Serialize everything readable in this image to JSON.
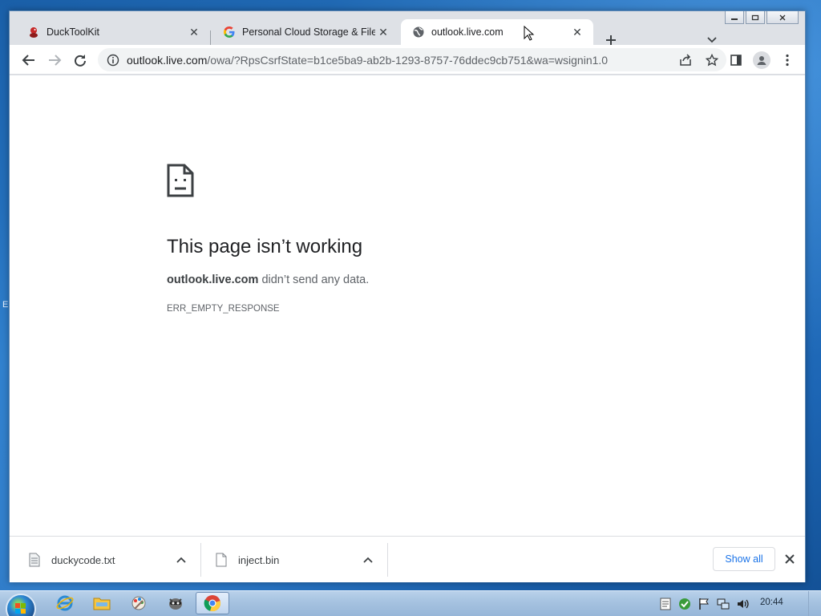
{
  "browser": {
    "tabs": [
      {
        "title": "DuckToolKit",
        "icon": "duck-favicon-icon",
        "active": false
      },
      {
        "title": "Personal Cloud Storage & File Sh",
        "icon": "google-favicon-icon",
        "active": false
      },
      {
        "title": "outlook.live.com",
        "icon": "globe-favicon-icon",
        "active": true
      }
    ],
    "url": {
      "host": "outlook.live.com",
      "rest": "/owa/?RpsCsrfState=b1ce5ba9-ab2b-1293-8757-76ddec9cb751&wa=wsignin1.0"
    }
  },
  "error": {
    "title": "This page isn’t working",
    "host": "outlook.live.com",
    "message": " didn’t send any data.",
    "code": "ERR_EMPTY_RESPONSE"
  },
  "downloads": {
    "items": [
      {
        "name": "duckycode.txt"
      },
      {
        "name": "inject.bin"
      }
    ],
    "show_all_label": "Show all"
  },
  "taskbar": {
    "clock": "20:44"
  },
  "desktop": {
    "edge_glyph": "E"
  },
  "colors": {
    "accent": "#1a73e8",
    "page_bg": "#ffffff",
    "tabstrip_bg": "#dee1e6"
  }
}
